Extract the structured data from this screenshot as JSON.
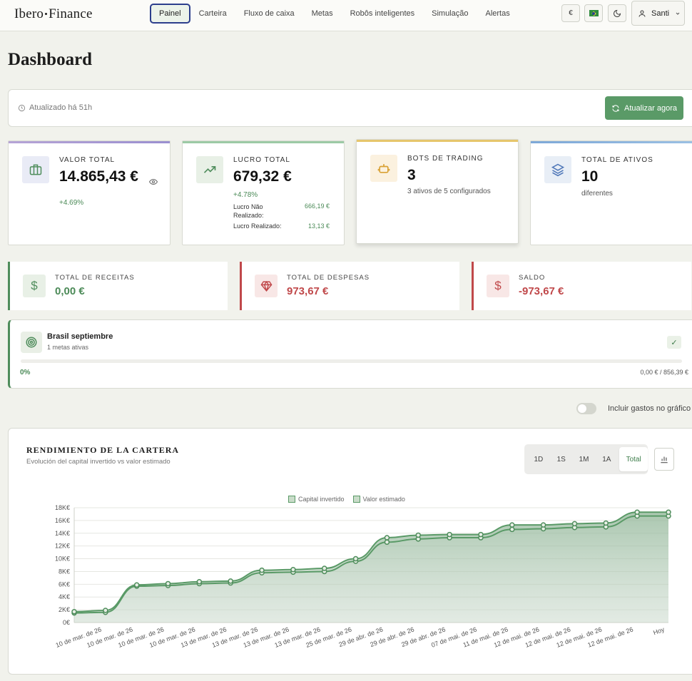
{
  "brand": {
    "left": "Ibero",
    "right": "Finance"
  },
  "nav": [
    {
      "label": "Painel",
      "active": true
    },
    {
      "label": "Carteira"
    },
    {
      "label": "Fluxo de caixa"
    },
    {
      "label": "Metas"
    },
    {
      "label": "Robôs inteligentes"
    },
    {
      "label": "Simulação"
    },
    {
      "label": "Alertas"
    }
  ],
  "topbar": {
    "currency": "€",
    "user": "Santi"
  },
  "page_title": "Dashboard",
  "update": {
    "text": "Atualizado há 51h",
    "button": "Atualizar agora"
  },
  "stats": {
    "total_value": {
      "label": "VALOR TOTAL",
      "value": "14.865,43 €",
      "pct": "+4.69%"
    },
    "total_profit": {
      "label": "LUCRO TOTAL",
      "value": "679,32 €",
      "pct": "+4.78%",
      "unrealized_label": "Lucro Não Realizado:",
      "unrealized_value": "666,19 €",
      "realized_label": "Lucro Realizado:",
      "realized_value": "13,13 €"
    },
    "bots": {
      "label": "BOTS DE TRADING",
      "value": "3",
      "sub": "3 ativos de 5 configurados"
    },
    "assets": {
      "label": "TOTAL DE ATIVOS",
      "value": "10",
      "sub": "diferentes"
    }
  },
  "finance": {
    "income": {
      "label": "TOTAL DE RECEITAS",
      "value": "0,00 €"
    },
    "expenses": {
      "label": "TOTAL DE DESPESAS",
      "value": "973,67 €"
    },
    "balance": {
      "label": "SALDO",
      "value": "-973,67 €"
    }
  },
  "goal": {
    "name": "Brasil septiembre",
    "sub": "1 metas ativas",
    "progress_pct": "0%",
    "progress": 0,
    "amount": "0,00 € / 856,39 €"
  },
  "toggle_label": "Incluir gastos no gráfico",
  "chart_card": {
    "title": "RENDIMIENTO DE LA CARTERA",
    "subtitle": "Evolución del capital invertido vs valor estimado",
    "ranges": [
      "1D",
      "1S",
      "1M",
      "1A",
      "Total"
    ],
    "active_range": "Total"
  },
  "colors": {
    "accent": "#5a9a67",
    "negative": "#c0484a",
    "positive": "#4b8a57"
  },
  "chart_data": {
    "type": "area",
    "categories": [
      "10 de mar. de 26",
      "10 de mar. de 26",
      "10 de mar. de 26",
      "10 de mar. de 26",
      "13 de mar. de 26",
      "13 de mar. de 26",
      "13 de mar. de 26",
      "13 de mar. de 26",
      "25 de mar. de 26",
      "29 de abr. de 26",
      "29 de abr. de 26",
      "29 de abr. de 26",
      "07 de mai. de 26",
      "11 de mai. de 26",
      "12 de mai. de 26",
      "12 de mai. de 26",
      "12 de mai. de 26",
      "12 de mai. de 26",
      "Hoy"
    ],
    "series": [
      {
        "name": "Capital invertido",
        "values": [
          1500,
          1600,
          5700,
          5800,
          6100,
          6200,
          7800,
          7900,
          8000,
          9600,
          12600,
          13100,
          13300,
          13300,
          14600,
          14700,
          14900,
          15000,
          16700,
          16700
        ]
      },
      {
        "name": "Valor estimado",
        "values": [
          1700,
          1900,
          5900,
          6100,
          6400,
          6500,
          8200,
          8300,
          8500,
          10000,
          13300,
          13700,
          13800,
          13800,
          15300,
          15300,
          15500,
          15600,
          17300,
          17300
        ]
      }
    ],
    "ylim": [
      0,
      18000
    ],
    "yticks": [
      "0€",
      "2K€",
      "4K€",
      "6K€",
      "8K€",
      "10K€",
      "12K€",
      "14K€",
      "16K€",
      "18K€"
    ],
    "grid": true,
    "legend_position": "top-center"
  }
}
